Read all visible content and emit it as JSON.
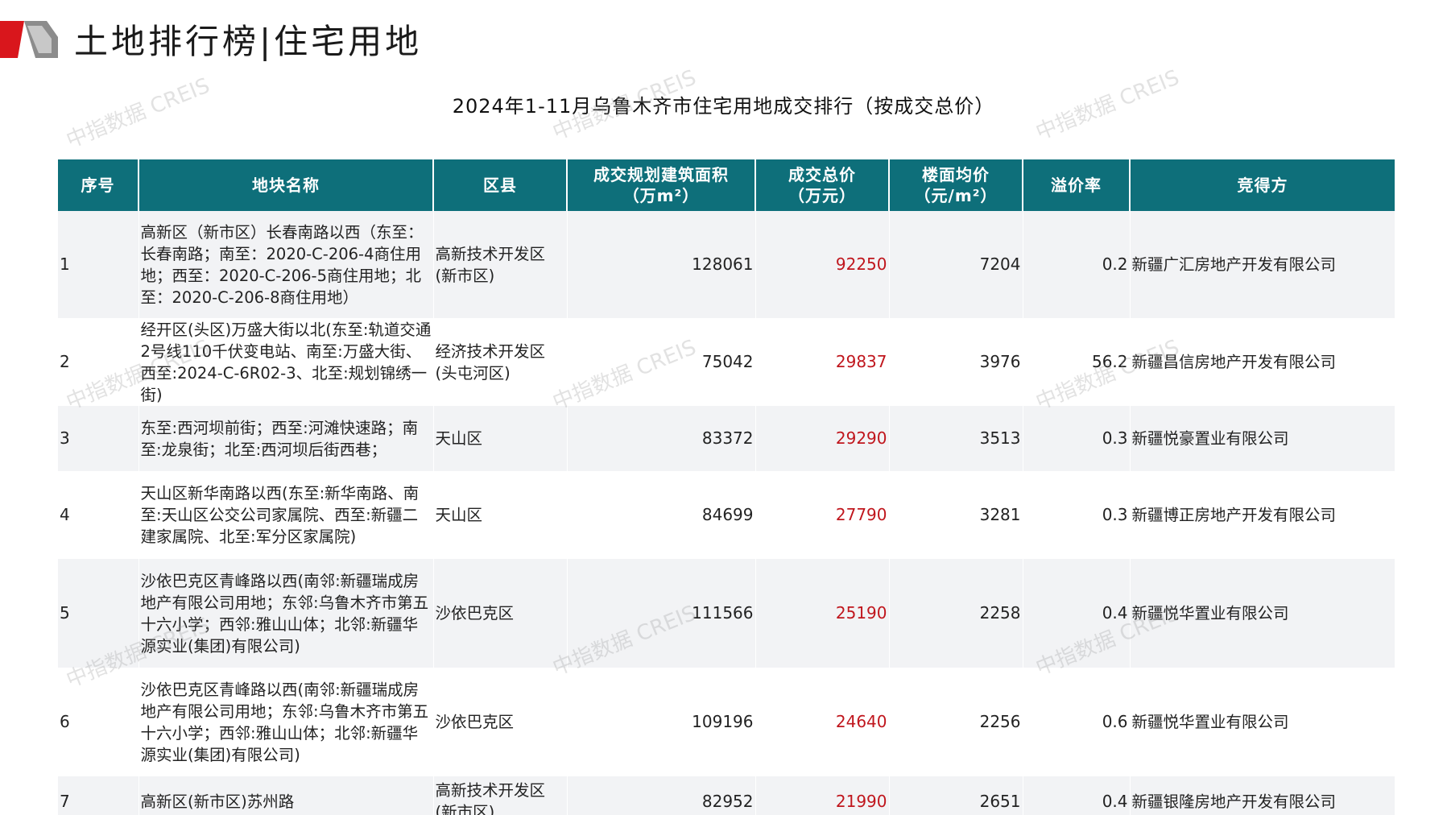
{
  "header": {
    "page_title": "土地排行榜|住宅用地",
    "table_title": "2024年1-11月乌鲁木齐市住宅用地成交排行（按成交总价）"
  },
  "watermark_text": "中指数据 CREIS",
  "colors": {
    "header_bg": "#0e6f7a",
    "price_text": "#c0161d",
    "logo_red": "#d9161c",
    "logo_gray": "#8c8c8c",
    "row_alt": "#f2f3f5"
  },
  "table": {
    "columns": [
      "序号",
      "地块名称",
      "区县",
      "成交规划建筑面积\n（万m²）",
      "成交总价\n（万元）",
      "楼面均价\n（元/m²）",
      "溢价率",
      "竞得方"
    ],
    "rows": [
      {
        "idx": "1",
        "name": "高新区（新市区）长春南路以西（东至：长春南路；南至：2020-C-206-4商住用地；西至：2020-C-206-5商住用地；北至：2020-C-206-8商住用地）",
        "district": "高新技术开发区(新市区)",
        "area": "128061",
        "total_price": "92250",
        "unit_price": "7204",
        "premium": "0.2",
        "winner": "新疆广汇房地产开发有限公司"
      },
      {
        "idx": "2",
        "name": "经开区(头区)万盛大街以北(东至:轨道交通2号线110千伏变电站、南至:万盛大街、西至:2024-C-6R02-3、北至:规划锦绣一街)",
        "district": "经济技术开发区(头屯河区)",
        "area": "75042",
        "total_price": "29837",
        "unit_price": "3976",
        "premium": "56.2",
        "winner": "新疆昌信房地产开发有限公司"
      },
      {
        "idx": "3",
        "name": "东至:西河坝前街；西至:河滩快速路；南至:龙泉街；北至:西河坝后街西巷；",
        "district": "天山区",
        "area": "83372",
        "total_price": "29290",
        "unit_price": "3513",
        "premium": "0.3",
        "winner": "新疆悦豪置业有限公司"
      },
      {
        "idx": "4",
        "name": "天山区新华南路以西(东至:新华南路、南至:天山区公交公司家属院、西至:新疆二建家属院、北至:军分区家属院)",
        "district": "天山区",
        "area": "84699",
        "total_price": "27790",
        "unit_price": "3281",
        "premium": "0.3",
        "winner": "新疆博正房地产开发有限公司"
      },
      {
        "idx": "5",
        "name": "沙依巴克区青峰路以西(南邻:新疆瑞成房地产有限公司用地；东邻:乌鲁木齐市第五十六小学；西邻:雅山山体；北邻:新疆华源实业(集团)有限公司)",
        "district": "沙依巴克区",
        "area": "111566",
        "total_price": "25190",
        "unit_price": "2258",
        "premium": "0.4",
        "winner": "新疆悦华置业有限公司"
      },
      {
        "idx": "6",
        "name": "沙依巴克区青峰路以西(南邻:新疆瑞成房地产有限公司用地；东邻:乌鲁木齐市第五十六小学；西邻:雅山山体；北邻:新疆华源实业(集团)有限公司)",
        "district": "沙依巴克区",
        "area": "109196",
        "total_price": "24640",
        "unit_price": "2256",
        "premium": "0.6",
        "winner": "新疆悦华置业有限公司"
      },
      {
        "idx": "7",
        "name": "高新区(新市区)苏州路",
        "district": "高新技术开发区(新市区)",
        "area": "82952",
        "total_price": "21990",
        "unit_price": "2651",
        "premium": "0.4",
        "winner": "新疆银隆房地产开发有限公司"
      }
    ]
  }
}
